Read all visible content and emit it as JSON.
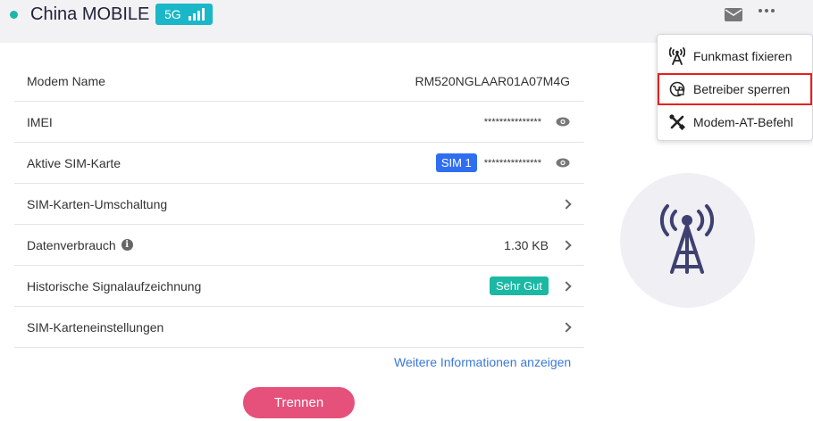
{
  "header": {
    "carrier_name": "China MOBILE",
    "network_type": "5G",
    "status_color": "#1fb5a8",
    "icons": [
      "mail-icon",
      "more-dots-icon"
    ]
  },
  "menu": {
    "items": [
      {
        "label": "Funkmast fixieren",
        "icon": "cell-tower-icon"
      },
      {
        "label": "Betreiber sperren",
        "icon": "operator-lock-icon",
        "highlighted": true
      },
      {
        "label": "Modem-AT-Befehl",
        "icon": "tools-icon"
      }
    ]
  },
  "info": {
    "rows": [
      {
        "label": "Modem Name",
        "value": "RM520NGLAAR01A07M4G"
      },
      {
        "label": "IMEI",
        "value": "***************"
      },
      {
        "label": "Aktive SIM-Karte",
        "badge": "SIM 1",
        "value": "***************"
      },
      {
        "label": "SIM-Karten-Umschaltung"
      },
      {
        "label": "Datenverbrauch",
        "value": "1.30 KB"
      },
      {
        "label": "Historische Signalaufzeichnung",
        "badge": "Sehr Gut"
      },
      {
        "label": "SIM-Karteneinstellungen"
      }
    ],
    "more_link": "Weitere Informationen anzeigen",
    "disconnect_label": "Trennen"
  },
  "colors": {
    "accent_teal": "#1bb8a3",
    "sim_blue": "#2f6ef0",
    "disconnect_pink": "#e5517a",
    "link_blue": "#3a78d8",
    "highlight_red": "#e8201c"
  }
}
